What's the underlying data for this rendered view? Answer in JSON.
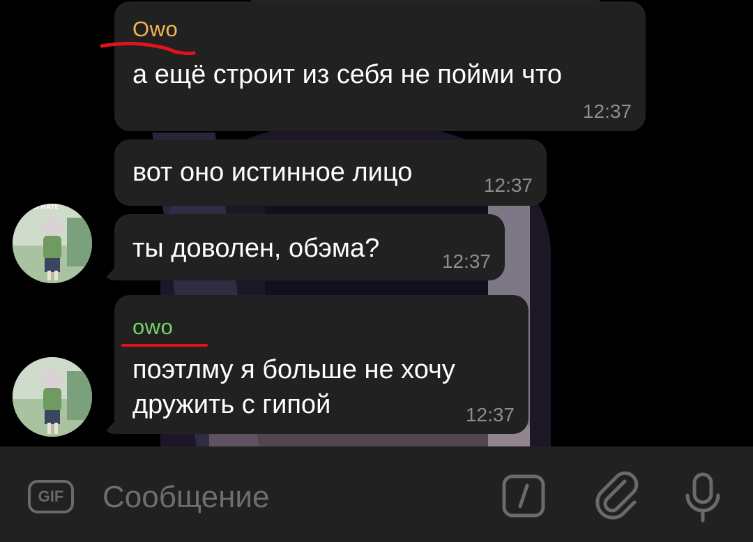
{
  "messages": [
    {
      "sender": "Owo",
      "sender_color": "#f4b44e",
      "text": "а ещё строит из себя не пойми что",
      "time": "12:37"
    },
    {
      "text": "вот оно истинное лицо",
      "time": "12:37"
    },
    {
      "text": "ты доволен, обэма?",
      "time": "12:37"
    },
    {
      "sender": "owo",
      "sender_color": "#74d46a",
      "text_lines": [
        "поэтлму я больше не хочу",
        "дружить с гипой"
      ],
      "time": "12:37"
    }
  ],
  "avatar_caption": "O HATE",
  "composer": {
    "gif_label": "GIF",
    "placeholder": "Сообщение"
  },
  "icons": [
    "gif-icon",
    "command-slash-icon",
    "attach-paperclip-icon",
    "microphone-icon"
  ],
  "colors": {
    "underline": "#e0141a",
    "bubble": "#212121",
    "bar": "#212121"
  }
}
